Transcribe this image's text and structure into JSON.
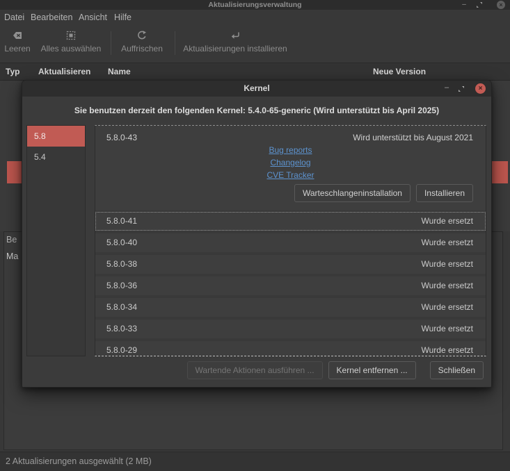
{
  "colors": {
    "accent_red": "#c15b54",
    "link_blue": "#5d93cf",
    "window_bg": "#383838",
    "titlebar_bg": "#2d2d2d"
  },
  "main_window": {
    "title": "Aktualisierungsverwaltung",
    "window_controls": {
      "minimize": "–",
      "close": "×"
    },
    "menu_items": [
      {
        "label": "Datei"
      },
      {
        "label": "Bearbeiten"
      },
      {
        "label": "Ansicht"
      },
      {
        "label": "Hilfe"
      }
    ],
    "toolbar_items": [
      {
        "icon": "clear-icon",
        "label": "Leeren"
      },
      {
        "icon": "select-all-icon",
        "label": "Alles auswählen"
      },
      {
        "icon": "refresh-icon",
        "label": "Auffrischen"
      },
      {
        "icon": "install-updates-icon",
        "label": "Aktualisierungen installieren"
      }
    ],
    "table": {
      "columns": [
        "Typ",
        "Aktualisieren",
        "Name",
        "Neue Version"
      ]
    },
    "description_panel": {
      "visible_label_fragment": "Be",
      "visible_text_fragment": "Ma"
    },
    "statusbar_text": "2 Aktualisierungen ausgewählt (2 MB)"
  },
  "kernel_dialog": {
    "title": "Kernel",
    "window_controls": {
      "minimize": "–",
      "close": "×"
    },
    "current_kernel_notice": "Sie benutzen derzeit den folgenden Kernel: 5.4.0-65-generic (Wird unterstützt bis April 2025)",
    "series_list": [
      {
        "label": "5.8",
        "selected": true
      },
      {
        "label": "5.4",
        "selected": false
      }
    ],
    "expanded_kernel": {
      "version": "5.8.0-43",
      "support_status": "Wird unterstützt bis August 2021",
      "links": [
        {
          "label": "Bug reports"
        },
        {
          "label": "Changelog"
        },
        {
          "label": "CVE Tracker"
        }
      ],
      "queue_button": "Warteschlangeninstallation",
      "install_button": "Installieren"
    },
    "kernel_rows": [
      {
        "version": "5.8.0-41",
        "status": "Wurde ersetzt",
        "focused": true
      },
      {
        "version": "5.8.0-40",
        "status": "Wurde ersetzt"
      },
      {
        "version": "5.8.0-38",
        "status": "Wurde ersetzt"
      },
      {
        "version": "5.8.0-36",
        "status": "Wurde ersetzt"
      },
      {
        "version": "5.8.0-34",
        "status": "Wurde ersetzt"
      },
      {
        "version": "5.8.0-33",
        "status": "Wurde ersetzt"
      },
      {
        "version": "5.8.0-29",
        "status": "Wurde ersetzt"
      }
    ],
    "footer_buttons": [
      {
        "label": "Wartende Aktionen ausführen ...",
        "disabled": true
      },
      {
        "label": "Kernel entfernen ...",
        "disabled": false
      },
      {
        "label": "Schließen",
        "disabled": false
      }
    ]
  }
}
